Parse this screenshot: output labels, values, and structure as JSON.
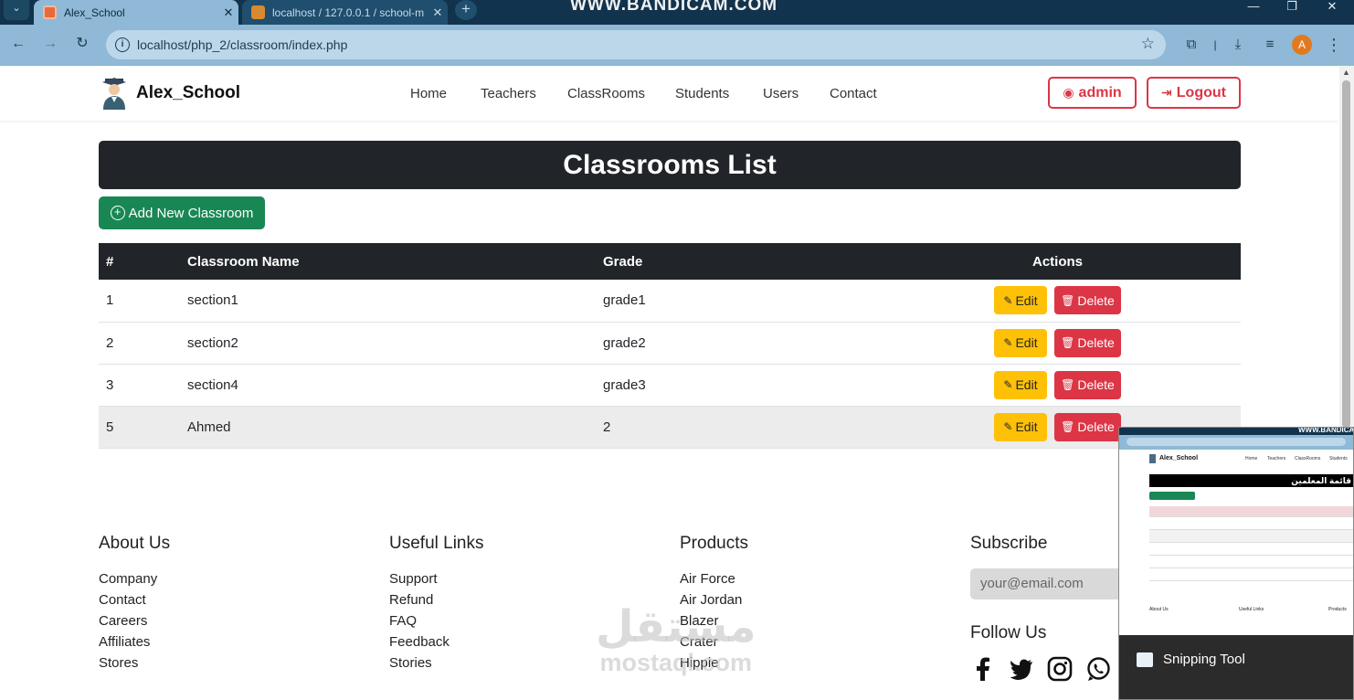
{
  "browser": {
    "tabs": [
      {
        "title": "Alex_School",
        "active": true
      },
      {
        "title": "localhost / 127.0.0.1 / school-m",
        "active": false
      }
    ],
    "recorder_watermark": "WWW.BANDICAM.COM",
    "url": "localhost/php_2/classroom/index.php",
    "profile_initial": "A"
  },
  "site": {
    "brand": "Alex_School",
    "nav": [
      "Home",
      "Teachers",
      "ClassRooms",
      "Students",
      "Users",
      "Contact"
    ],
    "user_button": "admin",
    "logout_button": "Logout"
  },
  "page": {
    "title": "Classrooms List",
    "add_button": "Add New Classroom"
  },
  "table": {
    "headers": [
      "#",
      "Classroom Name",
      "Grade",
      "Actions"
    ],
    "rows": [
      {
        "id": "1",
        "name": "section1",
        "grade": "grade1"
      },
      {
        "id": "2",
        "name": "section2",
        "grade": "grade2"
      },
      {
        "id": "3",
        "name": "section4",
        "grade": "grade3"
      },
      {
        "id": "5",
        "name": "Ahmed",
        "grade": "2"
      }
    ],
    "edit_label": "Edit",
    "delete_label": "Delete"
  },
  "footer": {
    "about": {
      "title": "About Us",
      "links": [
        "Company",
        "Contact",
        "Careers",
        "Affiliates",
        "Stores"
      ]
    },
    "useful": {
      "title": "Useful Links",
      "links": [
        "Support",
        "Refund",
        "FAQ",
        "Feedback",
        "Stories"
      ]
    },
    "products": {
      "title": "Products",
      "links": [
        "Air Force",
        "Air Jordan",
        "Blazer",
        "Crater",
        "Hippie"
      ]
    },
    "subscribe": {
      "title": "Subscribe",
      "placeholder": "your@email.com"
    },
    "follow_title": "Follow Us",
    "social_icons": [
      "facebook-icon",
      "twitter-icon",
      "instagram-icon",
      "whatsapp-icon"
    ]
  },
  "mostaql": {
    "arabic": "مستقل",
    "latin": "mostaql.com"
  },
  "overlay": {
    "title": "قائمة المعلمين",
    "brand": "Alex_School",
    "nav": [
      "Home",
      "Teachers",
      "ClassRooms",
      "Students"
    ],
    "watermark": "WWW.BANDICAM.CO",
    "footer": [
      "About Us",
      "Useful Links",
      "Products"
    ],
    "snipping_tool": "Snipping Tool"
  },
  "colors": {
    "danger": "#dc3545",
    "success": "#198754",
    "warning": "#ffc107",
    "dark": "#212529"
  }
}
